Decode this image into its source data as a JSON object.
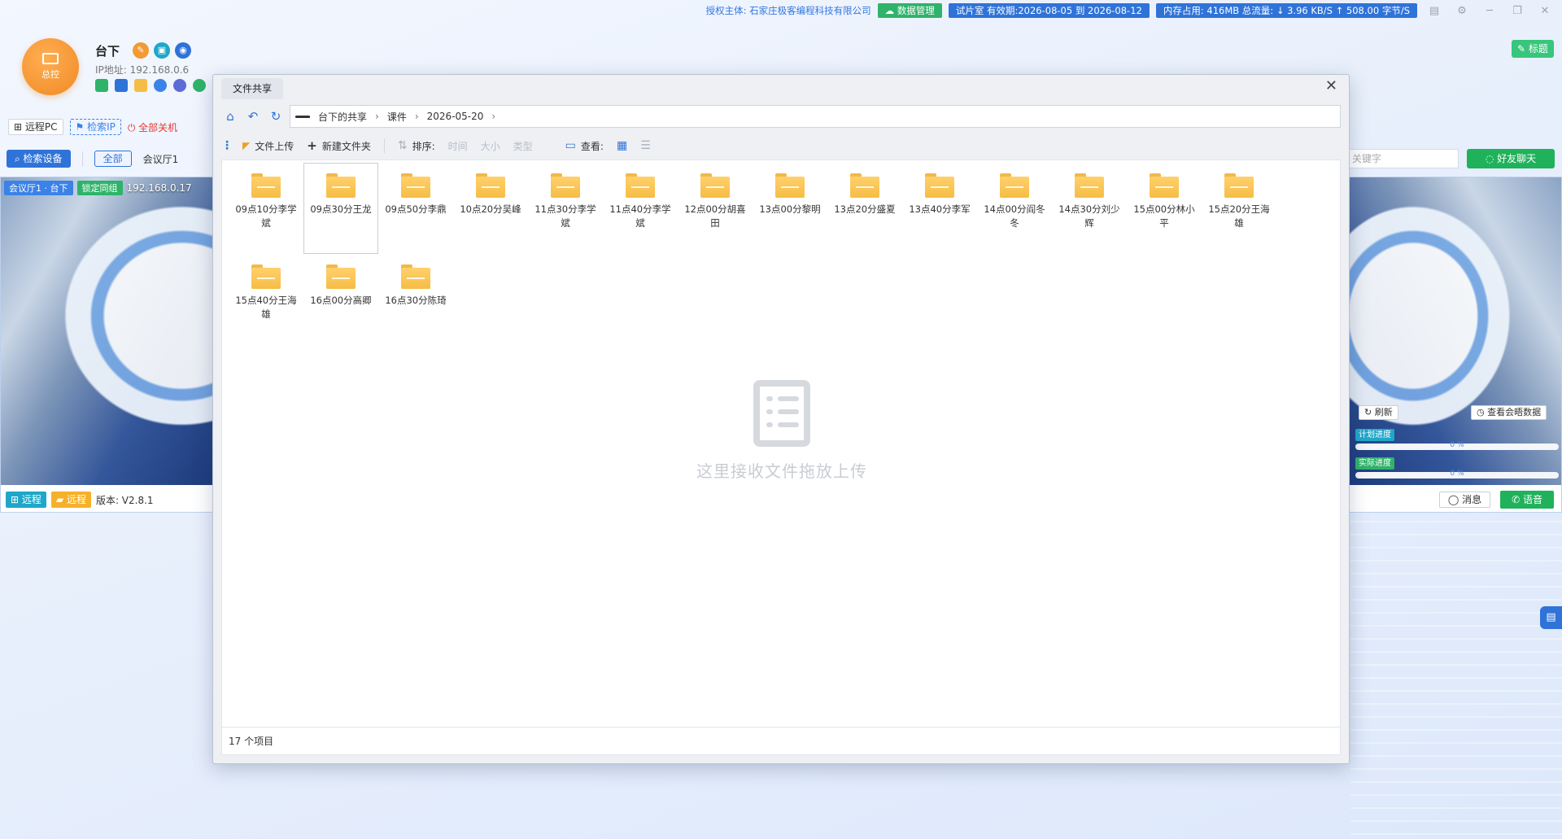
{
  "topbar": {
    "license_label": "授权主体:",
    "license_name": "石家庄极客编程科技有限公司",
    "data_mgmt": "数据管理",
    "trial": "试片室 有效期:2026-08-05 到 2026-08-12",
    "stats": "内存占用:  416MB    总流量:  ↓ 3.96 KB/S    ↑ 508.00 字节/S"
  },
  "profile": {
    "avatar_label": "总控",
    "name": "台下",
    "ip": "IP地址: 192.168.0.6"
  },
  "filters": {
    "remote_pc": "远程PC",
    "search_ip": "检索IP",
    "all_off": "全部关机"
  },
  "tabs": {
    "search_device": "检索设备",
    "all": "全部",
    "room": "会议厅1"
  },
  "left_card": {
    "room_tag": "会议厅1 · 台下",
    "lock_tag": "锁定同组",
    "ip": "192.168.0.17",
    "remote1": "远程",
    "remote2": "远程",
    "version": "版本: V2.8.1"
  },
  "right_panel": {
    "title_btn": "标题",
    "search_placeholder": "关键字",
    "friend_chat": "好友聊天",
    "refresh": "刷新",
    "view_meeting": "查看会晤数据",
    "plan_progress": "计划进度",
    "plan_pct": "0 %",
    "plan_value": 0,
    "actual_progress": "实际进度",
    "actual_pct": "0 %",
    "actual_value": 0,
    "message": "消息",
    "voice": "语音"
  },
  "dialog": {
    "title": "文件共享",
    "breadcrumb": [
      "台下的共享",
      "课件",
      "2026-05-20"
    ],
    "toolbar": {
      "upload": "文件上传",
      "new_folder": "新建文件夹",
      "sort": "排序:",
      "time": "时间",
      "size": "大小",
      "type": "类型",
      "view": "查看:"
    },
    "folders": [
      "09点10分李学斌",
      "09点30分王龙",
      "09点50分李鼎",
      "10点20分吴峰",
      "11点30分李学斌",
      "11点40分李学斌",
      "12点00分胡喜田",
      "13点00分黎明",
      "13点20分盛夏",
      "13点40分李军",
      "14点00分阎冬冬",
      "14点30分刘少辉",
      "15点00分林小平",
      "15点20分王海雄",
      "15点40分王海雄",
      "16点00分高卿",
      "16点30分陈琦"
    ],
    "drop_hint": "这里接收文件拖放上传",
    "status": "17 个项目"
  },
  "colors": {
    "accent": "#2f73d8",
    "green": "#2fb36a",
    "folder": "#f6bd45",
    "orange": "#f08a24"
  }
}
